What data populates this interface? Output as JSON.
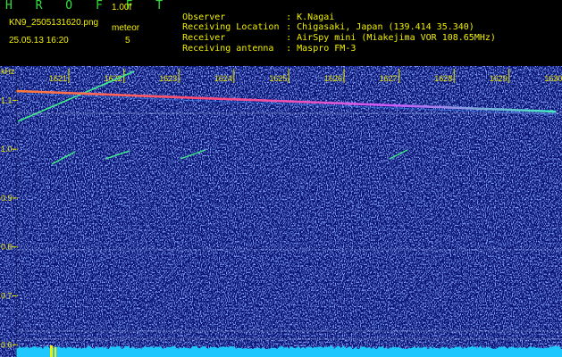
{
  "header": {
    "app_title": "H R O F F T",
    "version": "1.00f",
    "filename": "KN9_2505131620.png",
    "meteor_label": "meteor",
    "timestamp": "25.05.13 16:20",
    "meteor_count": "5"
  },
  "info": [
    {
      "label": "Observer",
      "value": "K.Nagai"
    },
    {
      "label": "Receiving Location",
      "value": "Chigasaki, Japan (139.414 35.340)"
    },
    {
      "label": "Receiver",
      "value": "AirSpy mini (Miakejima VOR 108.65MHz)"
    },
    {
      "label": "Receiving antenna",
      "value": "Maspro FM-3"
    }
  ],
  "spectrogram": {
    "unit_label": "kHz",
    "time_ticks": [
      "1621",
      "1622",
      "1623",
      "1624",
      "1625",
      "1626",
      "1627",
      "1628",
      "1629",
      "1630"
    ],
    "freq_ticks": [
      "1.1",
      "1.0",
      "0.9",
      "0.8",
      "0.7",
      "0.6"
    ],
    "freq_range": [
      0.575,
      1.17
    ],
    "colors": {
      "background": "#081273",
      "noise": "#3a58e8",
      "axis": "#e8e800",
      "signal_hot": "#ff6a3a",
      "signal_warm": "#3ef08a",
      "baseline": "#1ec8ff"
    }
  }
}
